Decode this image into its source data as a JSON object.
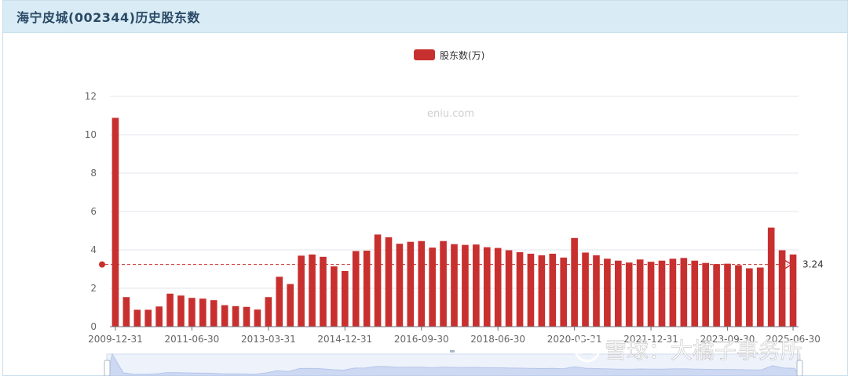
{
  "header": {
    "title": "海宁皮城(002344)历史股东数"
  },
  "chart_data": {
    "type": "bar",
    "title": "海宁皮城(002344)历史股东数",
    "legend": [
      "股东数(万)"
    ],
    "legend_position": "top-center",
    "watermark": "eniu.com",
    "series": [
      {
        "name": "股东数(万)",
        "color": "#c8302f",
        "values": [
          10.88,
          1.54,
          0.88,
          0.88,
          1.05,
          1.72,
          1.62,
          1.5,
          1.46,
          1.38,
          1.12,
          1.07,
          1.03,
          0.89,
          1.54,
          2.6,
          2.22,
          3.7,
          3.76,
          3.64,
          3.14,
          2.9,
          3.94,
          3.96,
          4.8,
          4.66,
          4.32,
          4.42,
          4.46,
          4.12,
          4.46,
          4.3,
          4.26,
          4.28,
          4.14,
          4.1,
          3.98,
          3.88,
          3.8,
          3.72,
          3.8,
          3.6,
          4.62,
          3.86,
          3.72,
          3.54,
          3.44,
          3.34,
          3.5,
          3.38,
          3.44,
          3.54,
          3.58,
          3.44,
          3.32,
          3.26,
          3.28,
          3.2,
          3.04,
          3.08,
          5.16,
          3.98,
          3.76
        ]
      }
    ],
    "x_tick_labels": [
      "2009-12-31",
      "2011-06-30",
      "2013-03-31",
      "2014-12-31",
      "2016-09-30",
      "2018-06-30",
      "2020-03-31",
      "2021-12-31",
      "2023-09-30",
      "2025-06-30"
    ],
    "x_tick_indices": [
      0,
      7,
      14,
      21,
      28,
      35,
      42,
      49,
      56,
      62
    ],
    "y_ticks": [
      0,
      2,
      4,
      6,
      8,
      10,
      12
    ],
    "ylim": [
      0,
      12
    ],
    "mark_line": {
      "value": 3.24,
      "label": "3.24",
      "color": "#c8302f"
    },
    "grid": true,
    "data_zoom": {
      "range": [
        0,
        100
      ]
    }
  },
  "overlay": {
    "brand_watermark": "雪球：大橘子事务所"
  }
}
